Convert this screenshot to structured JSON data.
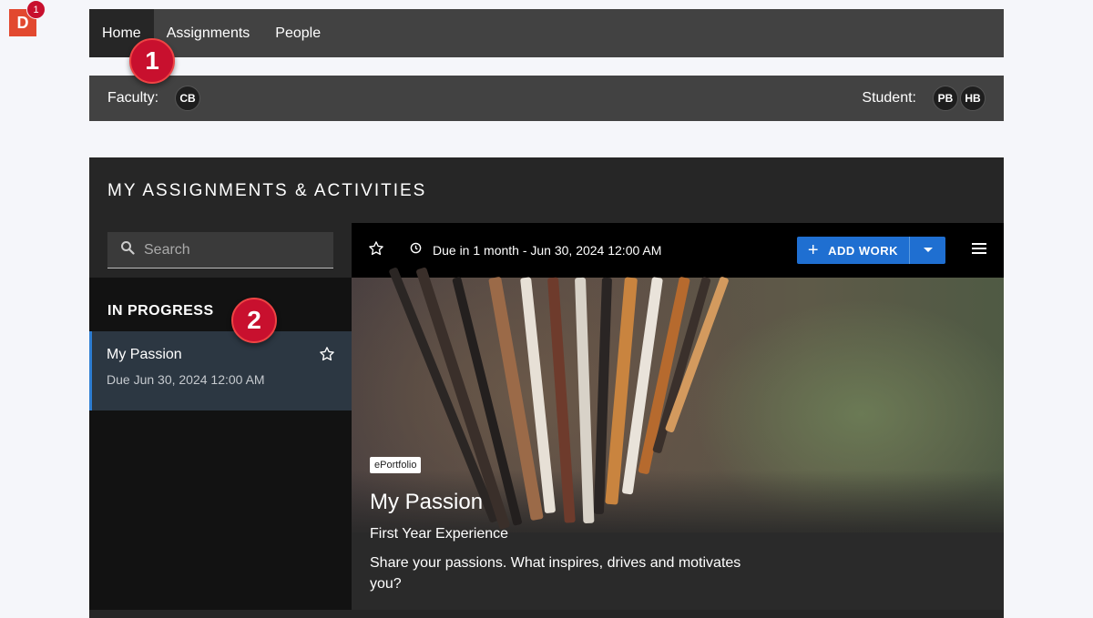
{
  "app": {
    "logo_letter": "D",
    "notification_count": "1"
  },
  "nav": {
    "tabs": [
      {
        "label": "Home"
      },
      {
        "label": "Assignments"
      },
      {
        "label": "People"
      }
    ]
  },
  "callouts": {
    "first": "1",
    "second": "2"
  },
  "members": {
    "faculty_label": "Faculty:",
    "faculty": [
      "CB"
    ],
    "student_label": "Student:",
    "students": [
      "PB",
      "HB"
    ]
  },
  "panel": {
    "title": "MY ASSIGNMENTS & ACTIVITIES",
    "search_placeholder": "Search",
    "section_title": "IN PROGRESS",
    "items": [
      {
        "title": "My Passion",
        "due": "Due Jun 30, 2024 12:00 AM"
      }
    ]
  },
  "detail": {
    "due_text": "Due in 1 month - Jun 30, 2024 12:00 AM",
    "add_work_label": "ADD WORK",
    "tag": "ePortfolio",
    "title": "My Passion",
    "subtitle": "First Year Experience",
    "description": "Share your passions. What inspires, drives and motivates you?"
  },
  "colors": {
    "accent": "#1f6fd1",
    "callout": "#c8102e",
    "logo": "#e2492f",
    "selected_border": "#2d7dd2"
  },
  "icons": [
    "search-icon",
    "star-outline-icon",
    "clock-icon",
    "plus-icon",
    "caret-down-icon",
    "hamburger-menu-icon"
  ]
}
